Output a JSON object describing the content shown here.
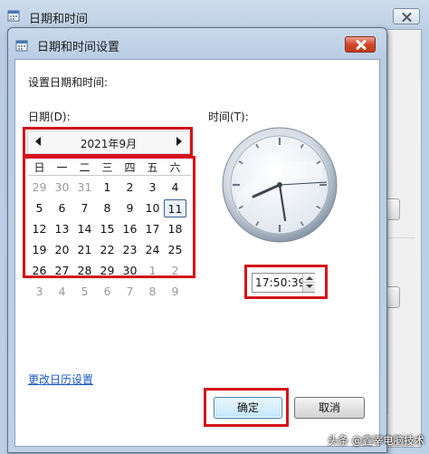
{
  "outer_window": {
    "title": "日期和时间"
  },
  "dialog": {
    "title": "日期和时间设置",
    "instruction": "设置日期和时间:",
    "date_label": "日期(D):",
    "time_label": "时间(T):",
    "calendar": {
      "month_title": "2021年9月",
      "weekdays": [
        "日",
        "一",
        "二",
        "三",
        "四",
        "五",
        "六"
      ],
      "rows": [
        [
          {
            "d": "29",
            "m": true
          },
          {
            "d": "30",
            "m": true
          },
          {
            "d": "31",
            "m": true
          },
          {
            "d": "1"
          },
          {
            "d": "2"
          },
          {
            "d": "3"
          },
          {
            "d": "4"
          }
        ],
        [
          {
            "d": "5"
          },
          {
            "d": "6"
          },
          {
            "d": "7"
          },
          {
            "d": "8"
          },
          {
            "d": "9"
          },
          {
            "d": "10"
          },
          {
            "d": "11",
            "today": true
          }
        ],
        [
          {
            "d": "12"
          },
          {
            "d": "13"
          },
          {
            "d": "14"
          },
          {
            "d": "15"
          },
          {
            "d": "16"
          },
          {
            "d": "17"
          },
          {
            "d": "18"
          }
        ],
        [
          {
            "d": "19"
          },
          {
            "d": "20"
          },
          {
            "d": "21"
          },
          {
            "d": "22"
          },
          {
            "d": "23"
          },
          {
            "d": "24"
          },
          {
            "d": "25"
          }
        ],
        [
          {
            "d": "26"
          },
          {
            "d": "27"
          },
          {
            "d": "28"
          },
          {
            "d": "29"
          },
          {
            "d": "30"
          },
          {
            "d": "1",
            "m": true
          },
          {
            "d": "2",
            "m": true
          }
        ],
        [
          {
            "d": "3",
            "m": true
          },
          {
            "d": "4",
            "m": true
          },
          {
            "d": "5",
            "m": true
          },
          {
            "d": "6",
            "m": true
          },
          {
            "d": "7",
            "m": true
          },
          {
            "d": "8",
            "m": true
          },
          {
            "d": "9",
            "m": true
          }
        ]
      ]
    },
    "time_value": "17:50:39",
    "calendar_settings_link": "更改日历设置",
    "ok_label": "确定",
    "cancel_label": "取消"
  },
  "watermark": "头条 @鑫宰电脑技术",
  "colors": {
    "annotation_red": "#d4141a",
    "link_blue": "#1a5bc4",
    "close_red": "#c23a1e"
  }
}
